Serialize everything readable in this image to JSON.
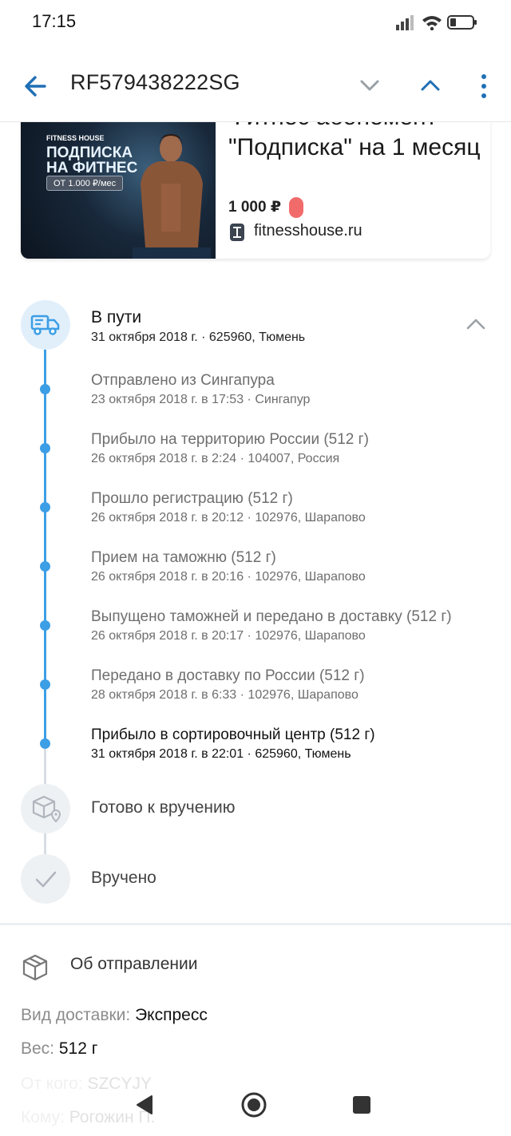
{
  "status_bar": {
    "time": "17:15"
  },
  "toolbar": {
    "title": "RF579438222SG"
  },
  "product": {
    "banner": {
      "brand": "FITNESS HOUSE",
      "headline": "ПОДПИСКА НА ФИТНЕС",
      "price_tag": "ОТ 1.000 ₽/мес"
    },
    "title": "Фитнес абонемент \"Подписка\" на 1 месяц",
    "price": "1 000 ₽",
    "shop": "fitnesshouse.ru",
    "colors": {
      "badge": "#f26b6b"
    }
  },
  "tracking": {
    "current": {
      "title": "В пути",
      "subtitle": "31 октября 2018 г. · 625960, Тюмень"
    },
    "events": [
      {
        "title": "Отправлено из Сингапура",
        "sub": "23 октября 2018 г. в 17:53 · Сингапур"
      },
      {
        "title": "Прибыло на территорию России (512 г)",
        "sub": "26 октября 2018 г. в 2:24 · 104007, Россия"
      },
      {
        "title": "Прошло регистрацию (512 г)",
        "sub": "26 октября 2018 г. в 20:12 · 102976, Шарапово"
      },
      {
        "title": "Прием на таможню (512 г)",
        "sub": "26 октября 2018 г. в 20:16 · 102976, Шарапово"
      },
      {
        "title": "Выпущено таможней и передано в доставку (512 г)",
        "sub": "26 октября 2018 г. в 20:17 · 102976, Шарапово"
      },
      {
        "title": "Передано в доставку по России (512 г)",
        "sub": "28 октября 2018 г. в 6:33 · 102976, Шарапово"
      },
      {
        "title": "Прибыло в сортировочный центр (512 г)",
        "sub": "31 октября 2018 г. в 22:01 · 625960, Тюмень"
      }
    ],
    "next_stages": [
      "Готово к вручению",
      "Вручено"
    ],
    "colors": {
      "accent": "#3c9ee5",
      "inactive": "#d8dde2"
    }
  },
  "about": {
    "title": "Об отправлении",
    "fields": [
      {
        "key": "Вид доставки:",
        "value": "Экспресс"
      },
      {
        "key": "Вес:",
        "value": "512 г"
      },
      {
        "key": "От кого:",
        "value": "SZCYJY"
      },
      {
        "key": "Кому:",
        "value": "Рогожин П."
      }
    ]
  }
}
